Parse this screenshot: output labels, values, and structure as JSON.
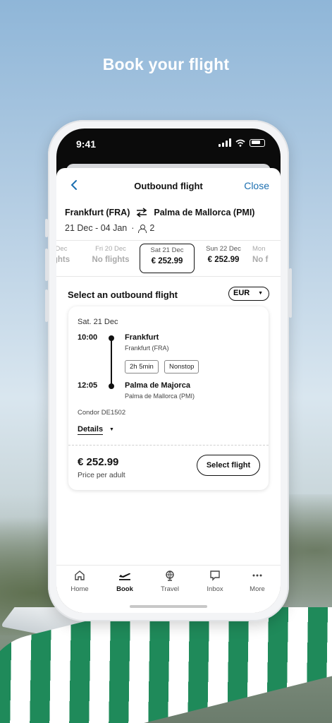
{
  "headline": "Book your flight",
  "status_bar": {
    "time": "9:41"
  },
  "nav": {
    "title": "Outbound flight",
    "close_label": "Close"
  },
  "route": {
    "origin": "Frankfurt (FRA)",
    "destination": "Palma de Mallorca (PMI)",
    "dates": "21 Dec - 04 Jan",
    "separator": "·",
    "passengers": "2"
  },
  "date_strip": [
    {
      "day": "Dec",
      "price": "ghts"
    },
    {
      "day": "Fri 20 Dec",
      "price": "No flights"
    },
    {
      "day": "Sat 21 Dec",
      "price": "€ 252.99"
    },
    {
      "day": "Sun 22 Dec",
      "price": "€ 252.99"
    },
    {
      "day": "Mon",
      "price": "No f"
    }
  ],
  "select_section": {
    "title": "Select an outbound flight",
    "currency": "EUR"
  },
  "flight_card": {
    "date": "Sat. 21 Dec",
    "departure": {
      "time": "10:00",
      "city": "Frankfurt",
      "airport": "Frankfurt (FRA)"
    },
    "arrival": {
      "time": "12:05",
      "city": "Palma de Majorca",
      "airport": "Palma de Mallorca (PMI)"
    },
    "duration": "2h 5min",
    "stops": "Nonstop",
    "carrier": "Condor DE1502",
    "details_label": "Details",
    "price": "€ 252.99",
    "price_note": "Price per adult",
    "select_label": "Select flight"
  },
  "tabs": [
    {
      "label": "Home",
      "icon": "home-icon"
    },
    {
      "label": "Book",
      "icon": "plane-icon"
    },
    {
      "label": "Travel",
      "icon": "globe-icon"
    },
    {
      "label": "Inbox",
      "icon": "chat-icon"
    },
    {
      "label": "More",
      "icon": "more-icon"
    }
  ],
  "colors": {
    "accent": "#1c6fb0",
    "brand_green": "#1f8a5a"
  }
}
